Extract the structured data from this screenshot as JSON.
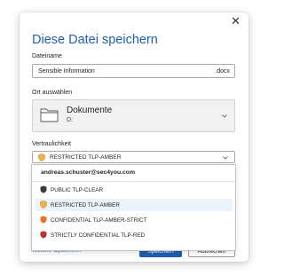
{
  "dialog": {
    "title": "Diese Datei speichern",
    "close_glyph": "✕"
  },
  "filename": {
    "label": "Dateiname",
    "value": "Sensible Information",
    "extension": ".docx"
  },
  "location": {
    "label": "Ort auswählen",
    "folder": "Dokumente",
    "drive": "D:",
    "icon": "folder-icon"
  },
  "confidentiality": {
    "label": "Vertraulichkeit",
    "selected": "RESTRICTED TLP-AMBER",
    "selected_icon_color": "#f2b33d",
    "dropdown": {
      "user": "andreas.schuster@sec4you.com",
      "options": [
        {
          "label": "PUBLIC TLP-CLEAR",
          "color": "#3a3a3a"
        },
        {
          "label": "RESTRICTED TLP-AMBER",
          "color": "#f2b33d",
          "highlighted": true
        },
        {
          "label": "CONFIDENTIAL TLP-AMBER-STRICT",
          "color": "#e8722a"
        },
        {
          "label": "STRICTLY CONFIDENTIAL TLP-RED",
          "color": "#b8322f"
        }
      ]
    }
  },
  "footer": {
    "more_options": "Weitere Optionen...",
    "save": "Speichern",
    "cancel": "Abbrechen"
  },
  "colors": {
    "accent": "#1f5fae",
    "highlight_bg": "#eaf3fc"
  }
}
